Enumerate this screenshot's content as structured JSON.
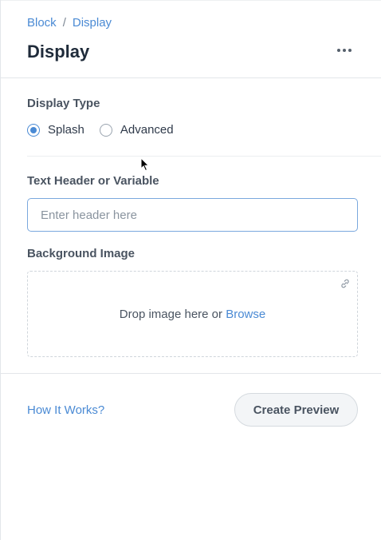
{
  "breadcrumb": {
    "parent": "Block",
    "separator": "/",
    "current": "Display"
  },
  "header": {
    "title": "Display",
    "more_icon": "more-horizontal-icon"
  },
  "display_type": {
    "label": "Display Type",
    "options": [
      {
        "label": "Splash",
        "selected": true
      },
      {
        "label": "Advanced",
        "selected": false
      }
    ]
  },
  "text_header": {
    "label": "Text Header or Variable",
    "value": "",
    "placeholder": "Enter header here"
  },
  "background_image": {
    "label": "Background Image",
    "drop_text": "Drop image here or ",
    "browse_label": "Browse",
    "link_icon": "link-icon"
  },
  "footer": {
    "how_link": "How It Works?",
    "preview_button": "Create Preview"
  },
  "colors": {
    "accent": "#4a8ad4",
    "title": "#1f2b3a",
    "label": "#4a5461",
    "border": "#e3e6ea"
  }
}
